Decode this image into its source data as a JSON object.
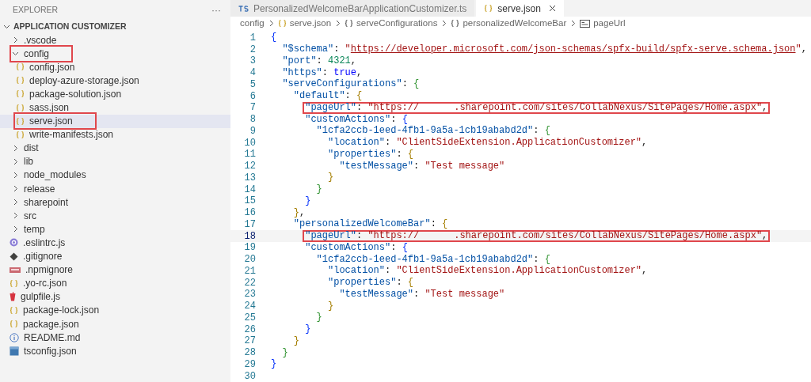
{
  "explorer": {
    "title": "EXPLORER",
    "more": "···",
    "section": "APPLICATION CUSTOMIZER",
    "section_expanded": true,
    "items": [
      {
        "kind": "folder",
        "label": ".vscode",
        "expanded": false,
        "selected": false,
        "highlighted": false
      },
      {
        "kind": "folder",
        "label": "config",
        "expanded": true,
        "selected": false,
        "highlighted": true,
        "children": [
          {
            "kind": "json",
            "label": "config.json",
            "selected": false,
            "highlighted": false
          },
          {
            "kind": "json",
            "label": "deploy-azure-storage.json",
            "selected": false,
            "highlighted": false
          },
          {
            "kind": "json",
            "label": "package-solution.json",
            "selected": false,
            "highlighted": false
          },
          {
            "kind": "json",
            "label": "sass.json",
            "selected": false,
            "highlighted": false
          },
          {
            "kind": "json",
            "label": "serve.json",
            "selected": true,
            "highlighted": true
          },
          {
            "kind": "json",
            "label": "write-manifests.json",
            "selected": false,
            "highlighted": false
          }
        ]
      },
      {
        "kind": "folder",
        "label": "dist",
        "expanded": false,
        "selected": false,
        "highlighted": false
      },
      {
        "kind": "folder",
        "label": "lib",
        "expanded": false,
        "selected": false,
        "highlighted": false
      },
      {
        "kind": "folder",
        "label": "node_modules",
        "expanded": false,
        "selected": false,
        "highlighted": false
      },
      {
        "kind": "folder",
        "label": "release",
        "expanded": false,
        "selected": false,
        "highlighted": false
      },
      {
        "kind": "folder",
        "label": "sharepoint",
        "expanded": false,
        "selected": false,
        "highlighted": false
      },
      {
        "kind": "folder",
        "label": "src",
        "expanded": false,
        "selected": false,
        "highlighted": false
      },
      {
        "kind": "folder",
        "label": "temp",
        "expanded": false,
        "selected": false,
        "highlighted": false
      },
      {
        "kind": "eslint",
        "label": ".eslintrc.js",
        "selected": false,
        "highlighted": false
      },
      {
        "kind": "git",
        "label": ".gitignore",
        "selected": false,
        "highlighted": false
      },
      {
        "kind": "npm",
        "label": ".npmignore",
        "selected": false,
        "highlighted": false
      },
      {
        "kind": "json",
        "label": ".yo-rc.json",
        "selected": false,
        "highlighted": false
      },
      {
        "kind": "gulp",
        "label": "gulpfile.js",
        "selected": false,
        "highlighted": false
      },
      {
        "kind": "json",
        "label": "package-lock.json",
        "selected": false,
        "highlighted": false
      },
      {
        "kind": "json",
        "label": "package.json",
        "selected": false,
        "highlighted": false
      },
      {
        "kind": "info",
        "label": "README.md",
        "selected": false,
        "highlighted": false
      },
      {
        "kind": "tsconfig",
        "label": "tsconfig.json",
        "selected": false,
        "highlighted": false
      }
    ]
  },
  "tabs": [
    {
      "kind": "ts",
      "label": "PersonalizedWelcomeBarApplicationCustomizer.ts",
      "selected": false
    },
    {
      "kind": "json",
      "label": "serve.json",
      "selected": true
    }
  ],
  "breadcrumb": [
    {
      "kind": "folder",
      "label": "config"
    },
    {
      "kind": "json",
      "label": "serve.json"
    },
    {
      "kind": "object",
      "label": "serveConfigurations"
    },
    {
      "kind": "object",
      "label": "personalizedWelcomeBar"
    },
    {
      "kind": "string",
      "label": "pageUrl"
    }
  ],
  "code_lines": [
    {
      "number": "1",
      "highlighted": false,
      "current": false,
      "tokens": [
        {
          "kind": "open",
          "text": "{"
        }
      ]
    },
    {
      "number": "2",
      "highlighted": false,
      "current": false,
      "tokens": [
        {
          "kind": "key",
          "text": "\"$schema\""
        },
        {
          "kind": "punct",
          "text": ": "
        },
        {
          "kind": "string",
          "text": "\""
        },
        {
          "kind": "link",
          "text": "https://developer.microsoft.com/json-schemas/spfx-build/spfx-serve.schema.json"
        },
        {
          "kind": "string",
          "text": "\""
        },
        {
          "kind": "punct",
          "text": ","
        }
      ]
    },
    {
      "number": "3",
      "highlighted": false,
      "current": false,
      "tokens": [
        {
          "kind": "key",
          "text": "\"port\""
        },
        {
          "kind": "punct",
          "text": ": "
        },
        {
          "kind": "number",
          "text": "4321"
        },
        {
          "kind": "punct",
          "text": ","
        }
      ]
    },
    {
      "number": "4",
      "highlighted": false,
      "current": false,
      "tokens": [
        {
          "kind": "key",
          "text": "\"https\""
        },
        {
          "kind": "punct",
          "text": ": "
        },
        {
          "kind": "bool",
          "text": "true"
        },
        {
          "kind": "punct",
          "text": ","
        }
      ]
    },
    {
      "number": "5",
      "highlighted": false,
      "current": false,
      "tokens": [
        {
          "kind": "key",
          "text": "\"serveConfigurations\""
        },
        {
          "kind": "punct",
          "text": ": "
        },
        {
          "kind": "open",
          "text": "{"
        }
      ]
    },
    {
      "number": "6",
      "highlighted": false,
      "current": false,
      "tokens": [
        {
          "kind": "key",
          "text": "\"default\""
        },
        {
          "kind": "punct",
          "text": ": "
        },
        {
          "kind": "open",
          "text": "{"
        }
      ]
    },
    {
      "number": "7",
      "highlighted": true,
      "current": false,
      "tokens": [
        {
          "kind": "key",
          "text": "\"pageUrl\""
        },
        {
          "kind": "punct",
          "text": ": "
        },
        {
          "kind": "string",
          "text": "\"https://"
        },
        {
          "kind": "redacted"
        },
        {
          "kind": "string",
          "text": ".sharepoint.com/sites/CollabNexus/SitePages/Home.aspx\""
        },
        {
          "kind": "punct",
          "text": ","
        }
      ]
    },
    {
      "number": "8",
      "highlighted": false,
      "current": false,
      "tokens": [
        {
          "kind": "key",
          "text": "\"customActions\""
        },
        {
          "kind": "punct",
          "text": ": "
        },
        {
          "kind": "open",
          "text": "{"
        }
      ]
    },
    {
      "number": "9",
      "highlighted": false,
      "current": false,
      "tokens": [
        {
          "kind": "key",
          "text": "\"1cfa2ccb-1eed-4fb1-9a5a-1cb19ababd2d\""
        },
        {
          "kind": "punct",
          "text": ": "
        },
        {
          "kind": "open",
          "text": "{"
        }
      ]
    },
    {
      "number": "10",
      "highlighted": false,
      "current": false,
      "tokens": [
        {
          "kind": "key",
          "text": "\"location\""
        },
        {
          "kind": "punct",
          "text": ": "
        },
        {
          "kind": "string",
          "text": "\"ClientSideExtension.ApplicationCustomizer\""
        },
        {
          "kind": "punct",
          "text": ","
        }
      ]
    },
    {
      "number": "11",
      "highlighted": false,
      "current": false,
      "tokens": [
        {
          "kind": "key",
          "text": "\"properties\""
        },
        {
          "kind": "punct",
          "text": ": "
        },
        {
          "kind": "open",
          "text": "{"
        }
      ]
    },
    {
      "number": "12",
      "highlighted": false,
      "current": false,
      "tokens": [
        {
          "kind": "key",
          "text": "\"testMessage\""
        },
        {
          "kind": "punct",
          "text": ": "
        },
        {
          "kind": "string",
          "text": "\"Test message\""
        }
      ]
    },
    {
      "number": "13",
      "highlighted": false,
      "current": false,
      "tokens": [
        {
          "kind": "close",
          "text": "}"
        }
      ]
    },
    {
      "number": "14",
      "highlighted": false,
      "current": false,
      "tokens": [
        {
          "kind": "close",
          "text": "}"
        }
      ]
    },
    {
      "number": "15",
      "highlighted": false,
      "current": false,
      "tokens": [
        {
          "kind": "close",
          "text": "}"
        }
      ]
    },
    {
      "number": "16",
      "highlighted": false,
      "current": false,
      "tokens": [
        {
          "kind": "close",
          "text": "}"
        },
        {
          "kind": "punct",
          "text": ","
        }
      ]
    },
    {
      "number": "17",
      "highlighted": false,
      "current": false,
      "tokens": [
        {
          "kind": "key",
          "text": "\"personalizedWelcomeBar\""
        },
        {
          "kind": "punct",
          "text": ": "
        },
        {
          "kind": "open",
          "text": "{"
        }
      ]
    },
    {
      "number": "18",
      "highlighted": true,
      "current": true,
      "tokens": [
        {
          "kind": "key",
          "text": "\"pageUrl\""
        },
        {
          "kind": "punct",
          "text": ": "
        },
        {
          "kind": "string",
          "text": "\"https://"
        },
        {
          "kind": "redacted"
        },
        {
          "kind": "string",
          "text": ".sharepoint.com/sites/CollabNexus/SitePages/Home.aspx\""
        },
        {
          "kind": "punct",
          "text": ","
        }
      ]
    },
    {
      "number": "19",
      "highlighted": false,
      "current": false,
      "tokens": [
        {
          "kind": "key",
          "text": "\"customActions\""
        },
        {
          "kind": "punct",
          "text": ": "
        },
        {
          "kind": "open",
          "text": "{"
        }
      ]
    },
    {
      "number": "20",
      "highlighted": false,
      "current": false,
      "tokens": [
        {
          "kind": "key",
          "text": "\"1cfa2ccb-1eed-4fb1-9a5a-1cb19ababd2d\""
        },
        {
          "kind": "punct",
          "text": ": "
        },
        {
          "kind": "open",
          "text": "{"
        }
      ]
    },
    {
      "number": "21",
      "highlighted": false,
      "current": false,
      "tokens": [
        {
          "kind": "key",
          "text": "\"location\""
        },
        {
          "kind": "punct",
          "text": ": "
        },
        {
          "kind": "string",
          "text": "\"ClientSideExtension.ApplicationCustomizer\""
        },
        {
          "kind": "punct",
          "text": ","
        }
      ]
    },
    {
      "number": "22",
      "highlighted": false,
      "current": false,
      "tokens": [
        {
          "kind": "key",
          "text": "\"properties\""
        },
        {
          "kind": "punct",
          "text": ": "
        },
        {
          "kind": "open",
          "text": "{"
        }
      ]
    },
    {
      "number": "23",
      "highlighted": false,
      "current": false,
      "tokens": [
        {
          "kind": "key",
          "text": "\"testMessage\""
        },
        {
          "kind": "punct",
          "text": ": "
        },
        {
          "kind": "string",
          "text": "\"Test message\""
        }
      ]
    },
    {
      "number": "24",
      "highlighted": false,
      "current": false,
      "tokens": [
        {
          "kind": "close",
          "text": "}"
        }
      ]
    },
    {
      "number": "25",
      "highlighted": false,
      "current": false,
      "tokens": [
        {
          "kind": "close",
          "text": "}"
        }
      ]
    },
    {
      "number": "26",
      "highlighted": false,
      "current": false,
      "tokens": [
        {
          "kind": "close",
          "text": "}"
        }
      ]
    },
    {
      "number": "27",
      "highlighted": false,
      "current": false,
      "tokens": [
        {
          "kind": "close",
          "text": "}"
        }
      ]
    },
    {
      "number": "28",
      "highlighted": false,
      "current": false,
      "tokens": [
        {
          "kind": "close",
          "text": "}"
        }
      ]
    },
    {
      "number": "29",
      "highlighted": false,
      "current": false,
      "tokens": [
        {
          "kind": "close",
          "text": "}"
        }
      ]
    },
    {
      "number": "30",
      "highlighted": false,
      "current": false
    }
  ]
}
